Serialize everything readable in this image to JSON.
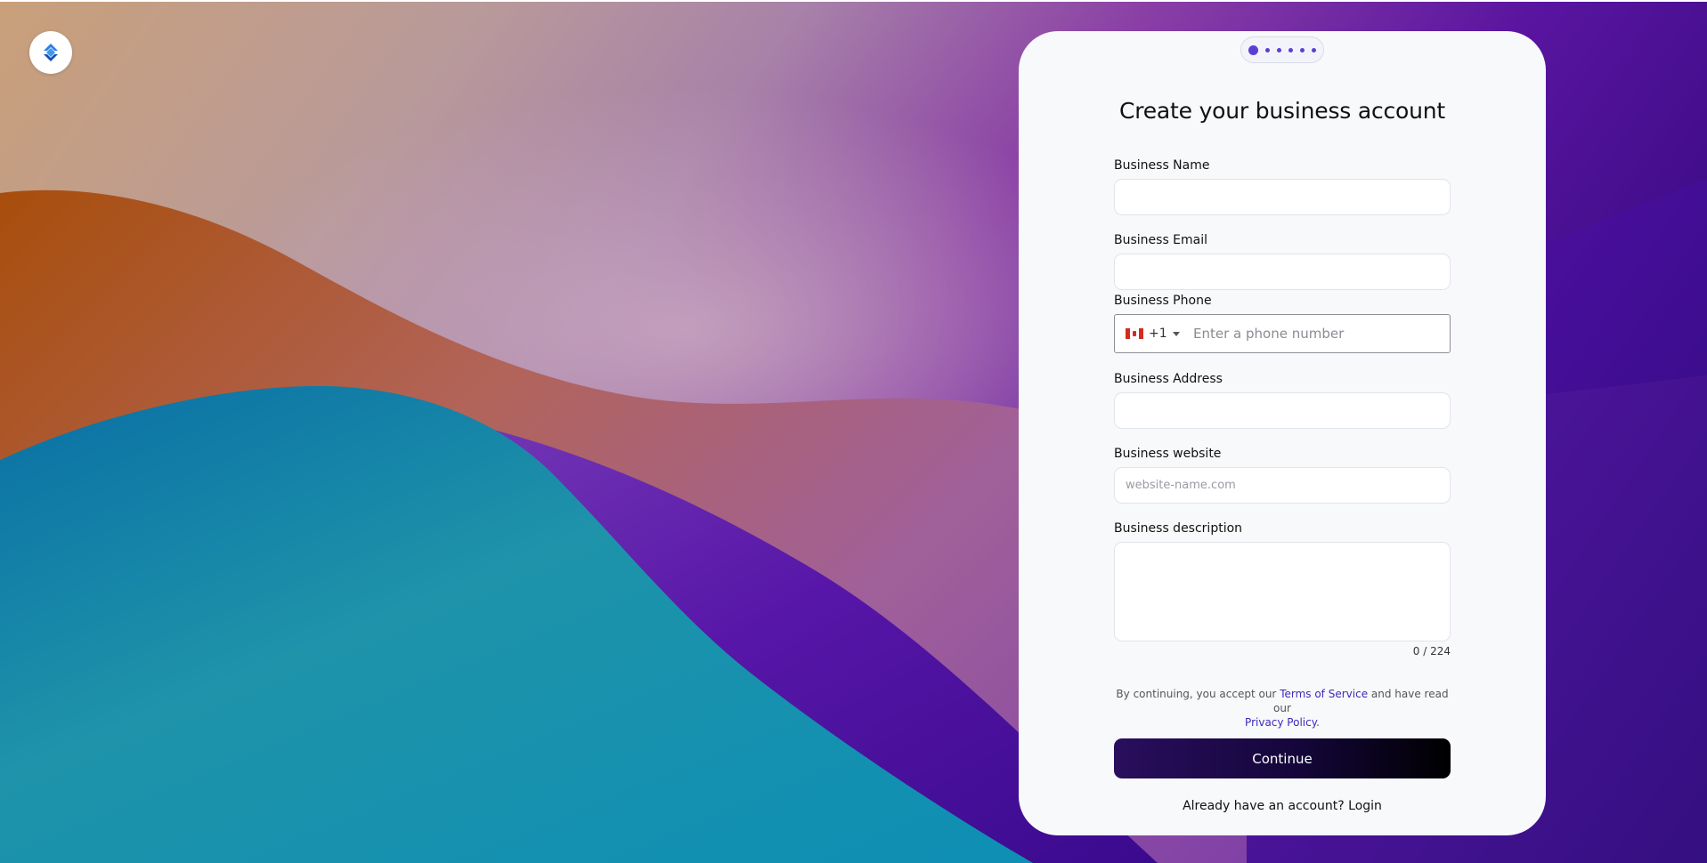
{
  "colors": {
    "accent": "#5b3fd4",
    "link": "#3a2bb8",
    "button_gradient_start": "#2a0e5e",
    "button_gradient_end": "#000000",
    "card_background": "#f8f9fb"
  },
  "logo": {
    "icon": "brand-logo-icon"
  },
  "stepper": {
    "total_steps": 6,
    "current_step": 1
  },
  "form": {
    "title": "Create your business account",
    "fields": {
      "business_name": {
        "label": "Business Name",
        "value": "",
        "placeholder": ""
      },
      "business_email": {
        "label": "Business Email",
        "value": "",
        "placeholder": ""
      },
      "business_phone": {
        "label": "Business Phone",
        "country_code": "+1",
        "country_flag": "canada-flag-icon",
        "value": "",
        "placeholder": "Enter a phone number"
      },
      "business_address": {
        "label": "Business Address",
        "value": "",
        "placeholder": ""
      },
      "business_website": {
        "label": "Business website",
        "value": "",
        "placeholder": "website-name.com"
      },
      "business_description": {
        "label": "Business description",
        "value": "",
        "counter": "0 / 224"
      }
    },
    "terms": {
      "prefix": "By continuing, you accept our ",
      "terms_link": "Terms of Service",
      "middle": " and have read our ",
      "privacy_link": "Privacy Policy",
      "suffix": "."
    },
    "continue_label": "Continue",
    "login_prompt": "Already have an account? ",
    "login_link": "Login"
  }
}
